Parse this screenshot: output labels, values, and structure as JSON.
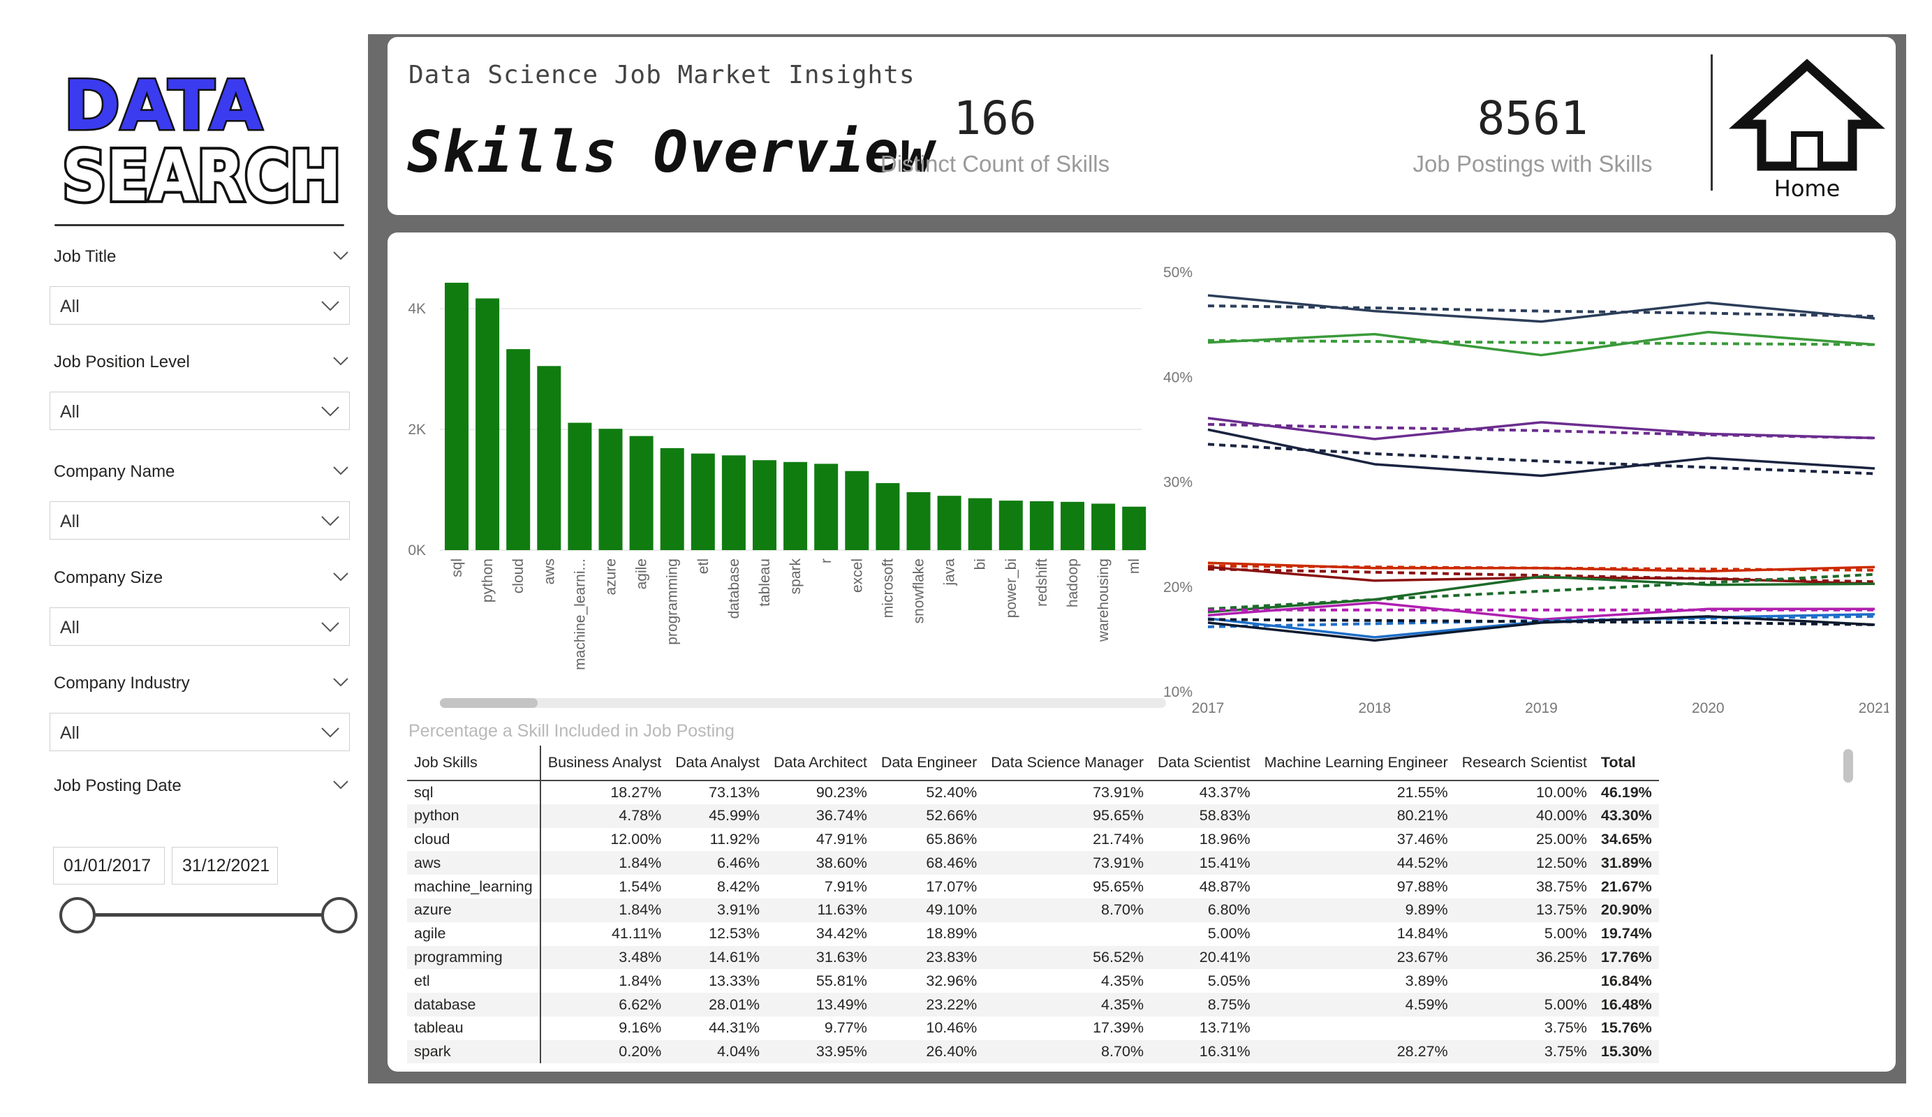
{
  "logo": {
    "line1": "DATA",
    "line2": "SEARCH"
  },
  "filters": [
    {
      "title": "Job Title",
      "value": "All"
    },
    {
      "title": "Job Position Level",
      "value": "All"
    },
    {
      "title": "Company Name",
      "value": "All"
    },
    {
      "title": "Company Size",
      "value": "All"
    },
    {
      "title": "Company Industry",
      "value": "All"
    }
  ],
  "date_filter": {
    "title": "Job Posting Date",
    "start": "01/01/2017",
    "end": "31/12/2021",
    "range_fraction": [
      0,
      1
    ]
  },
  "header": {
    "kicker": "Data Science Job Market Insights",
    "title": "Skills Overview",
    "kpis": [
      {
        "value": "166",
        "label": "Distinct Count of Skills"
      },
      {
        "value": "8561",
        "label": "Job Postings with Skills"
      }
    ],
    "home_label": "Home"
  },
  "colors": {
    "bar": "#107c10",
    "accent_dark": "#333333"
  },
  "chart_data": [
    {
      "type": "bar",
      "categories": [
        "sql",
        "python",
        "cloud",
        "aws",
        "machine_learni...",
        "azure",
        "agile",
        "programming",
        "etl",
        "database",
        "tableau",
        "spark",
        "r",
        "excel",
        "microsoft",
        "snowflake",
        "java",
        "bi",
        "power_bi",
        "redshift",
        "hadoop",
        "warehousing",
        "ml"
      ],
      "values": [
        4430,
        4170,
        3330,
        3050,
        2110,
        2010,
        1890,
        1690,
        1600,
        1570,
        1490,
        1460,
        1430,
        1310,
        1110,
        960,
        900,
        860,
        820,
        810,
        800,
        770,
        720
      ],
      "yticks": [
        "0K",
        "2K",
        "4K"
      ],
      "ylim": [
        0,
        4800
      ]
    },
    {
      "type": "line",
      "x": [
        "2017",
        "2018",
        "2019",
        "2020",
        "2021"
      ],
      "yticks": [
        "10%",
        "20%",
        "30%",
        "40%",
        "50%"
      ],
      "ylim": [
        10,
        50
      ],
      "series": [
        {
          "color": "#2c3e5a",
          "values": [
            47.8,
            46.3,
            45.3,
            47.1,
            45.6
          ],
          "trend": [
            46.8,
            46.6,
            46.3,
            46.1,
            45.8
          ]
        },
        {
          "color": "#3a9a3a",
          "values": [
            43.3,
            44.1,
            42.1,
            44.3,
            43.1
          ],
          "trend": [
            43.5,
            43.4,
            43.3,
            43.2,
            43.1
          ]
        },
        {
          "color": "#6b2d8f",
          "values": [
            36.1,
            34.1,
            35.7,
            34.6,
            34.2
          ],
          "trend": [
            35.5,
            35.2,
            34.9,
            34.5,
            34.2
          ]
        },
        {
          "color": "#1a2440",
          "values": [
            35.0,
            31.7,
            30.6,
            32.3,
            31.3
          ],
          "trend": [
            33.6,
            32.7,
            32.0,
            31.4,
            30.8
          ]
        },
        {
          "color": "#cc2b00",
          "values": [
            22.3,
            21.8,
            21.8,
            21.5,
            21.9
          ],
          "trend": [
            22.0,
            21.9,
            21.8,
            21.7,
            21.6
          ]
        },
        {
          "color": "#8b1010",
          "values": [
            21.9,
            20.6,
            20.9,
            20.8,
            20.3
          ],
          "trend": [
            21.7,
            21.4,
            21.1,
            20.8,
            20.5
          ]
        },
        {
          "color": "#1d6b2a",
          "values": [
            17.6,
            18.8,
            21.0,
            20.2,
            20.3
          ],
          "trend": [
            17.9,
            18.8,
            19.6,
            20.4,
            21.2
          ]
        },
        {
          "color": "#b01fb0",
          "values": [
            17.3,
            18.5,
            16.9,
            17.9,
            17.9
          ],
          "trend": [
            17.8,
            17.8,
            17.8,
            17.8,
            17.8
          ]
        },
        {
          "color": "#1e6fc9",
          "values": [
            17.0,
            15.2,
            16.7,
            17.1,
            17.4
          ],
          "trend": [
            16.2,
            16.5,
            16.8,
            17.0,
            17.2
          ]
        },
        {
          "color": "#0d1a2e",
          "values": [
            16.6,
            14.9,
            16.6,
            17.2,
            16.4
          ],
          "trend": [
            16.9,
            16.8,
            16.7,
            16.6,
            16.4
          ]
        }
      ]
    }
  ],
  "table": {
    "title": "Percentage a Skill Included in Job Posting",
    "columns": [
      "Job Skills",
      "Business Analyst",
      "Data Analyst",
      "Data Architect",
      "Data Engineer",
      "Data Science Manager",
      "Data Scientist",
      "Machine Learning Engineer",
      "Research Scientist",
      "Total"
    ],
    "rows": [
      [
        "sql",
        "18.27%",
        "73.13%",
        "90.23%",
        "52.40%",
        "73.91%",
        "43.37%",
        "21.55%",
        "10.00%",
        "46.19%"
      ],
      [
        "python",
        "4.78%",
        "45.99%",
        "36.74%",
        "52.66%",
        "95.65%",
        "58.83%",
        "80.21%",
        "40.00%",
        "43.30%"
      ],
      [
        "cloud",
        "12.00%",
        "11.92%",
        "47.91%",
        "65.86%",
        "21.74%",
        "18.96%",
        "37.46%",
        "25.00%",
        "34.65%"
      ],
      [
        "aws",
        "1.84%",
        "6.46%",
        "38.60%",
        "68.46%",
        "73.91%",
        "15.41%",
        "44.52%",
        "12.50%",
        "31.89%"
      ],
      [
        "machine_learning",
        "1.54%",
        "8.42%",
        "7.91%",
        "17.07%",
        "95.65%",
        "48.87%",
        "97.88%",
        "38.75%",
        "21.67%"
      ],
      [
        "azure",
        "1.84%",
        "3.91%",
        "11.63%",
        "49.10%",
        "8.70%",
        "6.80%",
        "9.89%",
        "13.75%",
        "20.90%"
      ],
      [
        "agile",
        "41.11%",
        "12.53%",
        "34.42%",
        "18.89%",
        "",
        "5.00%",
        "14.84%",
        "5.00%",
        "19.74%"
      ],
      [
        "programming",
        "3.48%",
        "14.61%",
        "31.63%",
        "23.83%",
        "56.52%",
        "20.41%",
        "23.67%",
        "36.25%",
        "17.76%"
      ],
      [
        "etl",
        "1.84%",
        "13.33%",
        "55.81%",
        "32.96%",
        "4.35%",
        "5.05%",
        "3.89%",
        "",
        "16.84%"
      ],
      [
        "database",
        "6.62%",
        "28.01%",
        "13.49%",
        "23.22%",
        "4.35%",
        "8.75%",
        "4.59%",
        "5.00%",
        "16.48%"
      ],
      [
        "tableau",
        "9.16%",
        "44.31%",
        "9.77%",
        "10.46%",
        "17.39%",
        "13.71%",
        "",
        "3.75%",
        "15.76%"
      ],
      [
        "spark",
        "0.20%",
        "4.04%",
        "33.95%",
        "26.40%",
        "8.70%",
        "16.31%",
        "28.27%",
        "3.75%",
        "15.30%"
      ]
    ]
  }
}
